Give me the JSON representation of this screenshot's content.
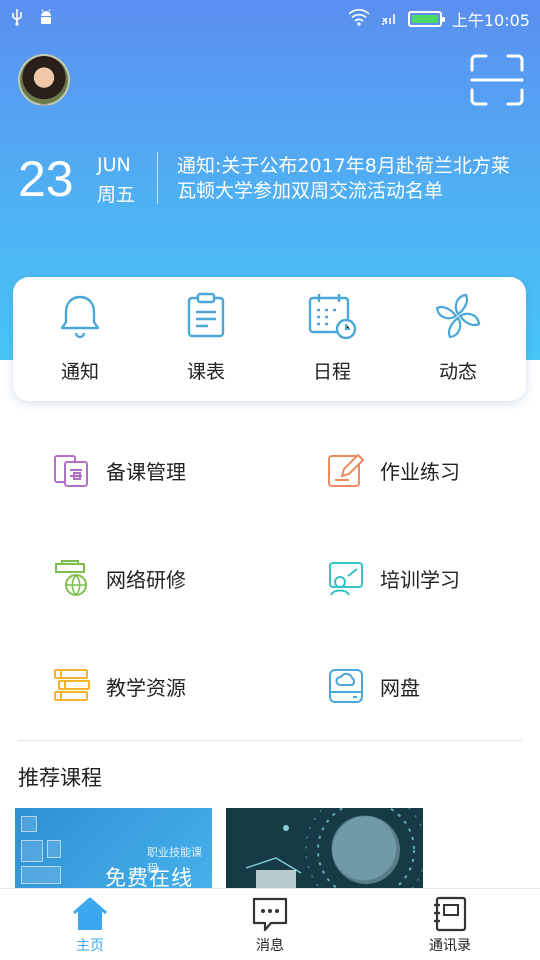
{
  "status_bar": {
    "time": "上午10:05",
    "icons": [
      "usb-icon",
      "android-icon",
      "wifi-icon",
      "signal-icon",
      "battery-icon"
    ],
    "battery_level": 1.0
  },
  "header": {
    "avatar": "user-avatar",
    "scan_icon": "scan-icon",
    "date_day": "23",
    "date_month": "JUN",
    "date_weekday": "周五",
    "notice_text": "通知:关于公布2017年8月赴荷兰北方莱瓦顿大学参加双周交流活动名单"
  },
  "quick_actions": [
    {
      "label": "通知",
      "icon": "bell-icon"
    },
    {
      "label": "课表",
      "icon": "clipboard-icon"
    },
    {
      "label": "日程",
      "icon": "calendar-clock-icon"
    },
    {
      "label": "动态",
      "icon": "pinwheel-icon"
    }
  ],
  "grid": [
    {
      "label": "备课管理",
      "icon": "lesson-prep-icon",
      "color": "#b46fc6"
    },
    {
      "label": "作业练习",
      "icon": "pencil-note-icon",
      "color": "#f08a5d"
    },
    {
      "label": "网络研修",
      "icon": "graduation-globe-icon",
      "color": "#7fbf4d"
    },
    {
      "label": "培训学习",
      "icon": "training-board-icon",
      "color": "#34c3c6"
    },
    {
      "label": "教学资源",
      "icon": "books-icon",
      "color": "#f2b52c"
    },
    {
      "label": "网盘",
      "icon": "cloud-drive-icon",
      "color": "#4aa7d8"
    }
  ],
  "recommended": {
    "title": "推荐课程",
    "courses": [
      {
        "small_text": "职业技能课程",
        "big_text": "免费在线学习"
      },
      {
        "image": "globe-network-image"
      }
    ]
  },
  "tabbar": {
    "tabs": [
      {
        "label": "主页",
        "icon": "home-icon",
        "active": true
      },
      {
        "label": "消息",
        "icon": "message-icon",
        "active": false
      },
      {
        "label": "通讯录",
        "icon": "contacts-icon",
        "active": false
      }
    ],
    "active_color": "#3aa7ee"
  },
  "colors": {
    "header_gradient_top": "#5b8ff0",
    "header_gradient_bottom": "#46c6f7",
    "icon_blue": "#4aa7d8"
  }
}
